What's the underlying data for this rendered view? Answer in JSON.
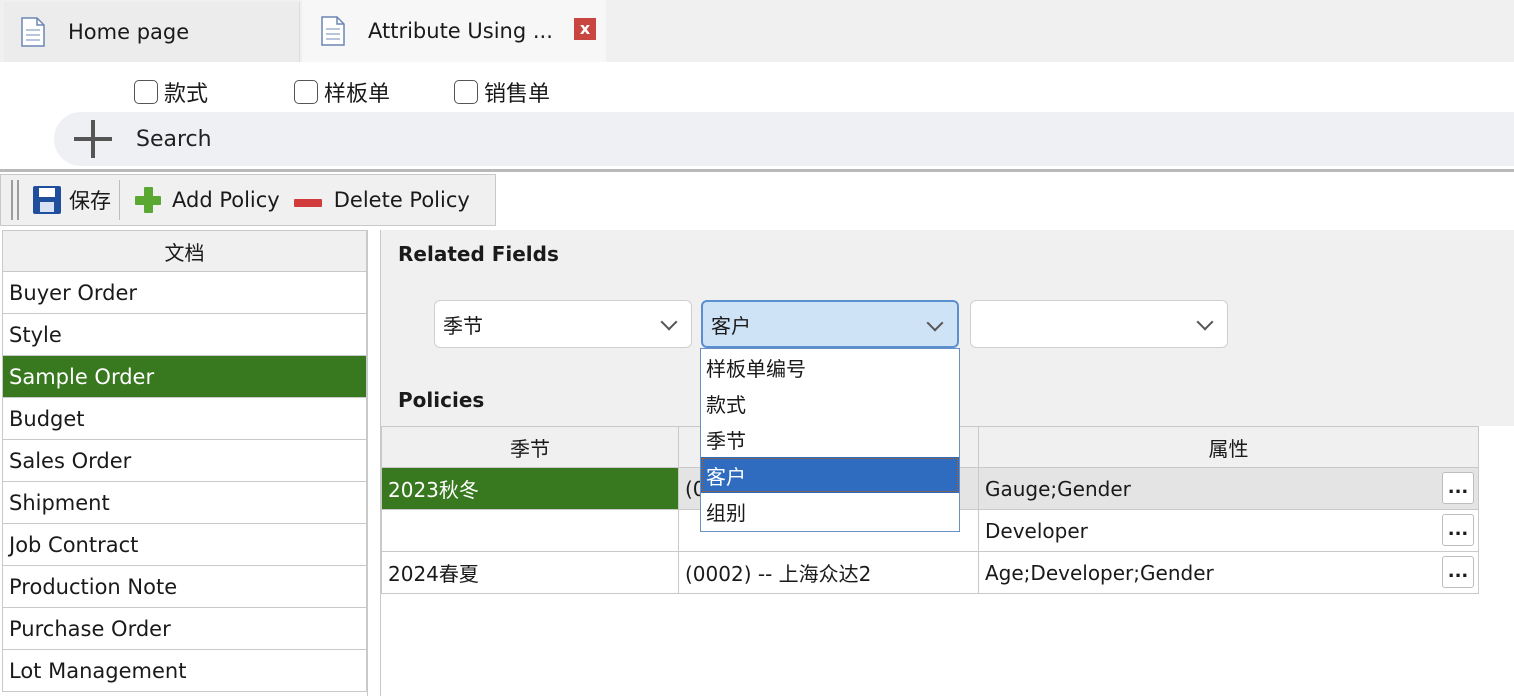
{
  "tabs": {
    "home": {
      "label": "Home page",
      "icon": "document-icon"
    },
    "active": {
      "label": "Attribute Using ...",
      "icon": "document-icon",
      "close_label": "x"
    }
  },
  "filters": {
    "checkboxes": [
      {
        "label": "款式",
        "checked": false
      },
      {
        "label": "样板单",
        "checked": false
      },
      {
        "label": "销售单",
        "checked": false
      }
    ]
  },
  "search": {
    "label": "Search",
    "icon": "plus-icon"
  },
  "toolbar": {
    "save_label": "保存",
    "add_label": "Add Policy",
    "delete_label": "Delete Policy"
  },
  "doclist": {
    "header": "文档",
    "selected_index": 2,
    "items": [
      "Buyer Order",
      "Style",
      "Sample Order",
      "Budget",
      "Sales Order",
      "Shipment",
      "Job Contract",
      "Production Note",
      "Purchase Order",
      "Lot Management"
    ]
  },
  "related_fields": {
    "title": "Related Fields",
    "combos": [
      {
        "value": "季节"
      },
      {
        "value": "客户",
        "open": true
      },
      {
        "value": ""
      }
    ],
    "dropdown_options": [
      "样板单编号",
      "款式",
      "季节",
      "客户",
      "组别"
    ],
    "dropdown_highlight_index": 3
  },
  "policies": {
    "title": "Policies",
    "columns": [
      "季节",
      "",
      "属性"
    ],
    "rows": [
      {
        "season": "2023秋冬",
        "customer": "(0",
        "attributes": "Gauge;Gender",
        "button": "..."
      },
      {
        "season": "",
        "customer": "",
        "attributes": "Developer",
        "button": "..."
      },
      {
        "season": "2024春夏",
        "customer": "(0002) -- 上海众达2",
        "attributes": "Age;Developer;Gender",
        "button": "..."
      }
    ]
  },
  "colors": {
    "selected_green": "#38781f",
    "highlight_blue": "#2f6cc0",
    "close_red": "#c9453f"
  }
}
